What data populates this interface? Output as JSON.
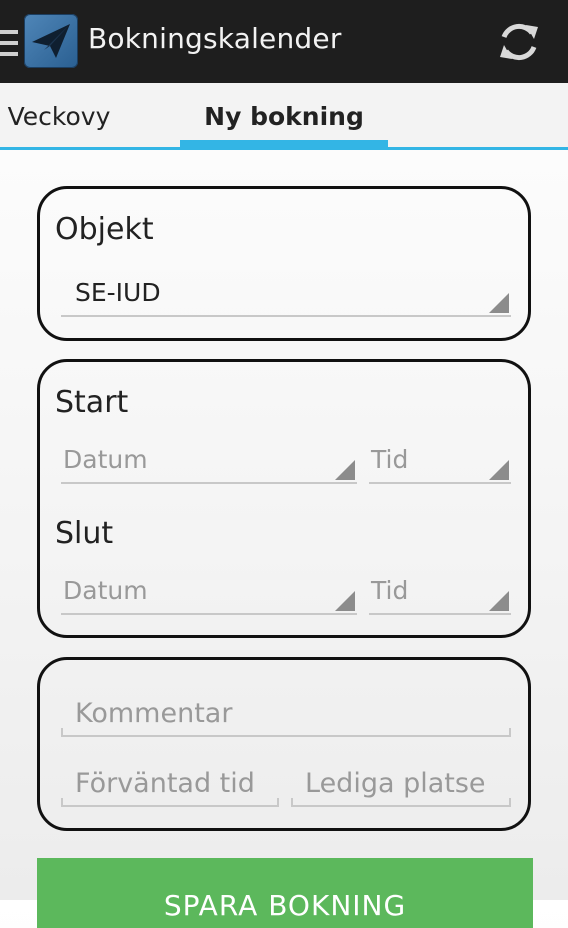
{
  "app": {
    "title": "Bokningskalender",
    "accent_color": "#33b5e5",
    "icons": [
      "drawer-icon",
      "paper-plane-icon",
      "refresh-icon"
    ]
  },
  "tabs": [
    {
      "label": "Veckovy",
      "selected": false
    },
    {
      "label": "Ny bokning",
      "selected": true
    }
  ],
  "objekt": {
    "label": "Objekt",
    "selected_value": "SE-IUD"
  },
  "start": {
    "label": "Start",
    "date_placeholder": "Datum",
    "time_placeholder": "Tid"
  },
  "slut": {
    "label": "Slut",
    "date_placeholder": "Datum",
    "time_placeholder": "Tid"
  },
  "comment": {
    "placeholder": "Kommentar",
    "value": ""
  },
  "expected_time": {
    "placeholder": "Förväntad tid",
    "value": ""
  },
  "free_seats": {
    "placeholder": "Lediga platse",
    "value": ""
  },
  "save_button": {
    "label": "SPARA BOKNING",
    "color": "#5cb85c"
  }
}
